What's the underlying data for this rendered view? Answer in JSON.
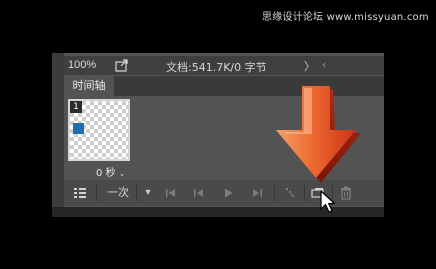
{
  "watermark": "思缘设计论坛 www.missyuan.com",
  "status_bar": {
    "zoom": "100%",
    "export_icon": "export-icon",
    "doc_info": "文档:541.7K/0 字节",
    "chevron_right": "〉",
    "chevron_left": "‹"
  },
  "tab": {
    "label": "时间轴"
  },
  "frame": {
    "number": "1",
    "delay": "0 秒",
    "delay_arrow": "⌄",
    "swatch_color": "#1f6fb0"
  },
  "toolbar": {
    "convert_icon": "convert-to-frame-animation-icon",
    "loop_label": "一次",
    "loop_arrow": "▾",
    "first_frame_icon": "first-frame-icon",
    "prev_frame_icon": "previous-frame-icon",
    "play_icon": "play-icon",
    "next_frame_icon": "next-frame-icon",
    "tween_icon": "tween-icon",
    "duplicate_icon": "duplicate-frame-icon",
    "delete_icon": "trash-icon"
  },
  "overlay": {
    "arrow_color": "#e8622c",
    "arrow_icon": "down-arrow-icon",
    "cursor_icon": "mouse-pointer-icon"
  }
}
